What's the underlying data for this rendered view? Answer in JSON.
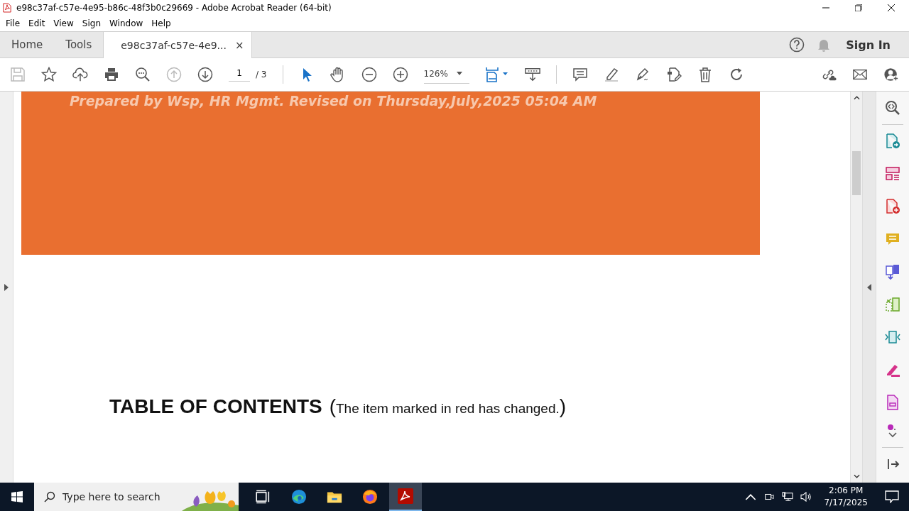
{
  "window": {
    "title": "e98c37af-c57e-4e95-b86c-48f3b0c29669 - Adobe Acrobat Reader (64-bit)"
  },
  "menu": [
    "File",
    "Edit",
    "View",
    "Sign",
    "Window",
    "Help"
  ],
  "tabs": [
    {
      "label": "Home",
      "selected": false,
      "closable": false
    },
    {
      "label": "Tools",
      "selected": false,
      "closable": false
    },
    {
      "label": "e98c37af-c57e-4e9...",
      "selected": true,
      "closable": true
    }
  ],
  "close_glyph": "×",
  "sign_in": "Sign In",
  "toolbar": {
    "page": "1",
    "page_total": "/ 3",
    "zoom": "126%"
  },
  "document": {
    "header_line": "Prepared by Wsp, HR Mgmt. Revised on Thursday,July,2025 05:04 AM",
    "toc_title": "TABLE OF CONTENTS",
    "toc_note_open": "(",
    "toc_note": "The item marked in red has changed.",
    "toc_note_close": ")"
  },
  "taskbar": {
    "search_placeholder": "Type here to search",
    "time": "2:06 PM",
    "date": "7/17/2025"
  }
}
